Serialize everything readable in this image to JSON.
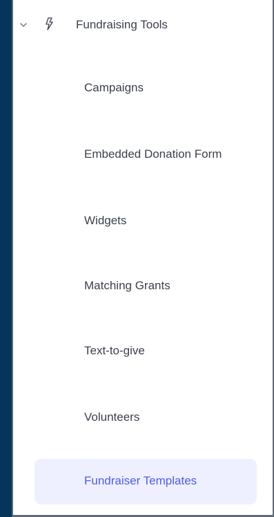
{
  "section": {
    "label": "Fundraising Tools",
    "expanded": true,
    "icon": "lightning-bolt-icon",
    "expand_icon": "chevron-down-icon"
  },
  "items": [
    {
      "label": "Campaigns",
      "active": false
    },
    {
      "label": "Embedded Donation Form",
      "active": false
    },
    {
      "label": "Widgets",
      "active": false
    },
    {
      "label": "Matching Grants",
      "active": false
    },
    {
      "label": "Text-to-give",
      "active": false
    },
    {
      "label": "Volunteers",
      "active": false
    },
    {
      "label": "Fundraiser Templates",
      "active": true
    }
  ],
  "colors": {
    "background": "#05355a",
    "panel": "#ffffff",
    "text": "#3a3f4b",
    "active_text": "#4d5ce0",
    "active_background": "#eef0ff"
  }
}
